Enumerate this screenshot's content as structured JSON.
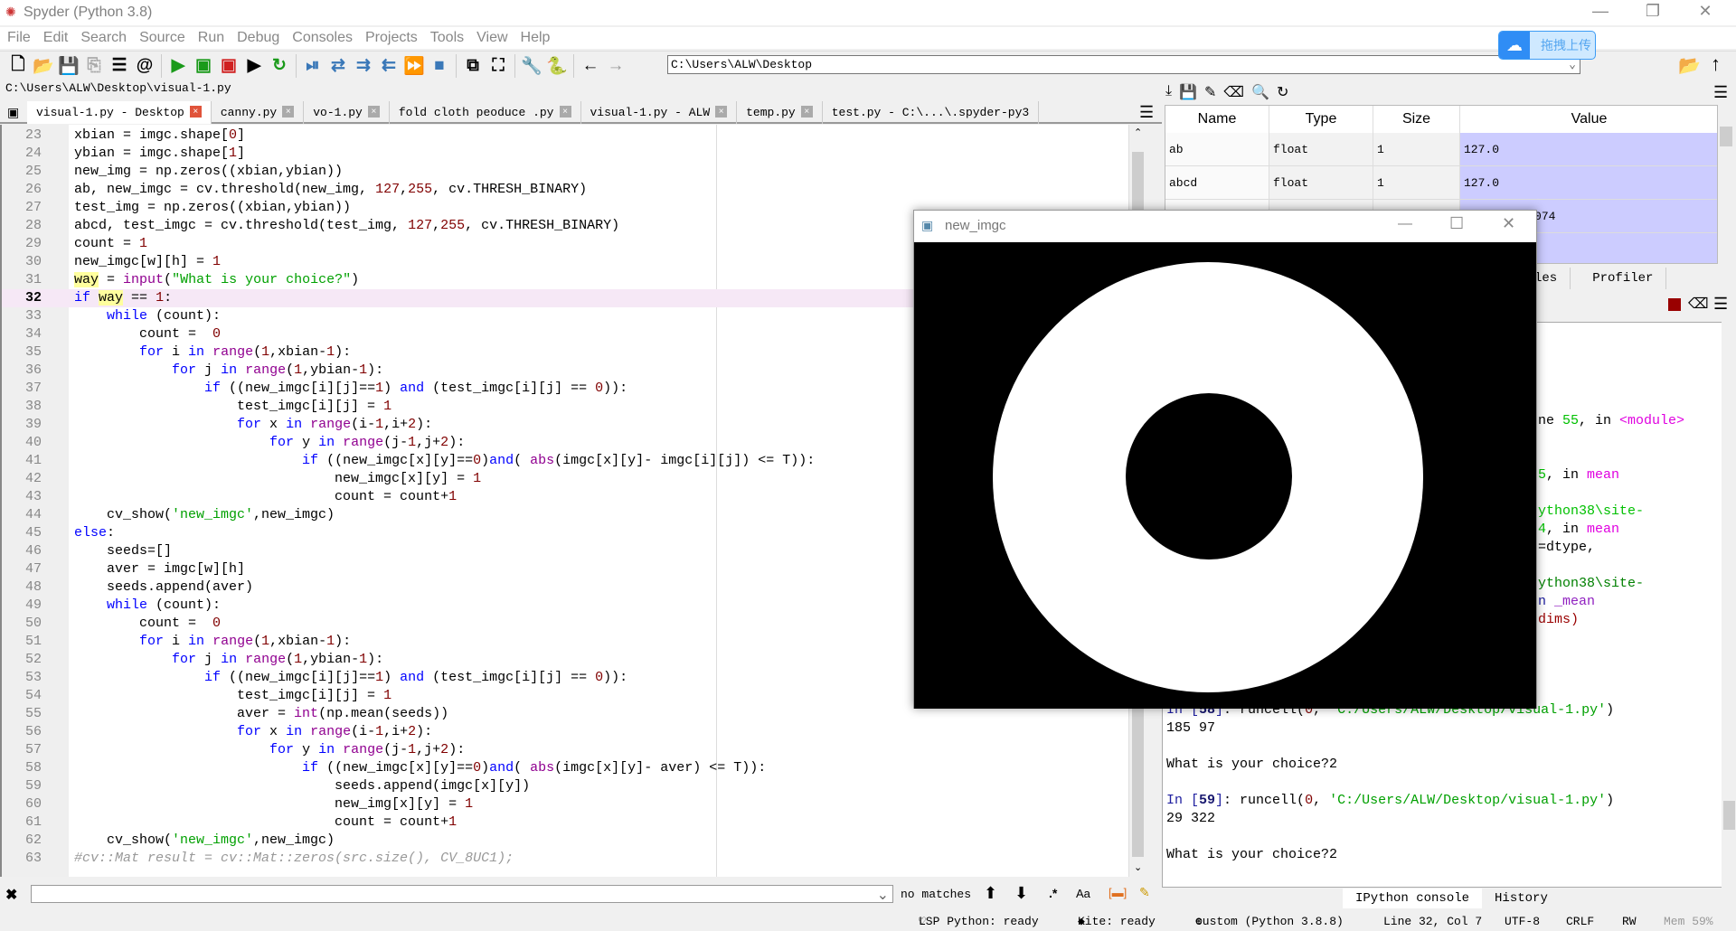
{
  "window": {
    "title": "Spyder (Python 3.8)",
    "minimize": "—",
    "restore": "❐",
    "close": "✕"
  },
  "menu": [
    "File",
    "Edit",
    "Search",
    "Source",
    "Run",
    "Debug",
    "Consoles",
    "Projects",
    "Tools",
    "View",
    "Help"
  ],
  "toolbar": {
    "icons": [
      {
        "name": "new-file-icon",
        "g": "🗋",
        "c": "#000"
      },
      {
        "name": "open-file-icon",
        "g": "📂",
        "c": "#000"
      },
      {
        "name": "save-icon",
        "g": "💾",
        "c": "#aaa"
      },
      {
        "name": "save-all-icon",
        "g": "⎘",
        "c": "#aaa"
      },
      {
        "name": "outline-icon",
        "g": "☰",
        "c": "#000"
      },
      {
        "name": "at-icon",
        "g": "@",
        "c": "#000"
      },
      "sep",
      {
        "name": "run-icon",
        "g": "▶",
        "c": "#1a9a1a"
      },
      {
        "name": "run-cell-icon",
        "g": "▣",
        "c": "#1a9a1a"
      },
      {
        "name": "run-cell-advance-icon",
        "g": "▣",
        "c": "#d02020"
      },
      {
        "name": "run-selection-icon",
        "g": "▶",
        "c": "#000"
      },
      {
        "name": "rerun-icon",
        "g": "↻",
        "c": "#1a9a1a"
      },
      "sep",
      {
        "name": "debug-icon",
        "g": "⏯",
        "c": "#3a78b8"
      },
      {
        "name": "step-icon",
        "g": "⇄",
        "c": "#3a78b8"
      },
      {
        "name": "step-into-icon",
        "g": "⇉",
        "c": "#3a78b8"
      },
      {
        "name": "step-return-icon",
        "g": "⇇",
        "c": "#3a78b8"
      },
      {
        "name": "continue-icon",
        "g": "⏩",
        "c": "#3a78b8"
      },
      {
        "name": "stop-debug-icon",
        "g": "■",
        "c": "#3a78b8"
      },
      "sep",
      {
        "name": "maximize-pane-icon",
        "g": "⧉",
        "c": "#000"
      },
      {
        "name": "fullscreen-icon",
        "g": "⛶",
        "c": "#000"
      },
      "sep",
      {
        "name": "preferences-wrench-icon",
        "g": "🔧",
        "c": "#000"
      },
      {
        "name": "python-path-icon",
        "g": "🐍",
        "c": "#e0b020"
      },
      "sep",
      {
        "name": "back-arrow-icon",
        "g": "←",
        "c": "#000"
      },
      {
        "name": "forward-arrow-icon",
        "g": "→",
        "c": "#999"
      }
    ],
    "path": "C:\\Users\\ALW\\Desktop"
  },
  "upload_button": {
    "label": "拖拽上传"
  },
  "editor": {
    "filepath": "C:\\Users\\ALW\\Desktop\\visual-1.py",
    "tabs": [
      "visual-1.py - Desktop",
      "canny.py",
      "vo-1.py",
      "fold cloth peoduce .py",
      "visual-1.py - ALW",
      "temp.py",
      "test.py - C:\\...\\.spyder-py3"
    ],
    "current_line": 32,
    "lines": [
      [
        [
          "n",
          "xbian = imgc.shape["
        ],
        [
          "num",
          "0"
        ],
        [
          "n",
          "]"
        ]
      ],
      [
        [
          "n",
          "ybian = imgc.shape["
        ],
        [
          "num",
          "1"
        ],
        [
          "n",
          "]"
        ]
      ],
      [
        [
          "n",
          "new_img = np.zeros((xbian,ybian))"
        ]
      ],
      [
        [
          "n",
          "ab, new_imgc = cv.threshold(new_img, "
        ],
        [
          "num",
          "127"
        ],
        [
          "n",
          ","
        ],
        [
          "num",
          "255"
        ],
        [
          "n",
          ", cv.THRESH_BINARY)"
        ]
      ],
      [
        [
          "n",
          "test_img = np.zeros((xbian,ybian))"
        ]
      ],
      [
        [
          "n",
          "abcd, test_imgc = cv.threshold(test_img, "
        ],
        [
          "num",
          "127"
        ],
        [
          "n",
          ","
        ],
        [
          "num",
          "255"
        ],
        [
          "n",
          ", cv.THRESH_BINARY)"
        ]
      ],
      [
        [
          "n",
          "count = "
        ],
        [
          "num",
          "1"
        ]
      ],
      [
        [
          "n",
          "new_imgc[w][h] = "
        ],
        [
          "num",
          "1"
        ]
      ],
      [
        [
          "h",
          "way"
        ],
        [
          "n",
          " = "
        ],
        [
          "b",
          "input"
        ],
        [
          "n",
          "("
        ],
        [
          "s",
          "\"What is your choice?\""
        ],
        [
          "n",
          ")"
        ]
      ],
      [
        [
          "k",
          "if"
        ],
        [
          "n",
          " "
        ],
        [
          "h",
          "way"
        ],
        [
          "n",
          " == "
        ],
        [
          "num",
          "1"
        ],
        [
          "n",
          ":"
        ]
      ],
      [
        [
          "n",
          "    "
        ],
        [
          "k",
          "while"
        ],
        [
          "n",
          " (count):"
        ]
      ],
      [
        [
          "n",
          "        count =  "
        ],
        [
          "num",
          "0"
        ]
      ],
      [
        [
          "n",
          "        "
        ],
        [
          "k",
          "for"
        ],
        [
          "n",
          " i "
        ],
        [
          "k",
          "in"
        ],
        [
          "n",
          " "
        ],
        [
          "b",
          "range"
        ],
        [
          "n",
          "("
        ],
        [
          "num",
          "1"
        ],
        [
          "n",
          ",xbian-"
        ],
        [
          "num",
          "1"
        ],
        [
          "n",
          "):"
        ]
      ],
      [
        [
          "n",
          "            "
        ],
        [
          "k",
          "for"
        ],
        [
          "n",
          " j "
        ],
        [
          "k",
          "in"
        ],
        [
          "n",
          " "
        ],
        [
          "b",
          "range"
        ],
        [
          "n",
          "("
        ],
        [
          "num",
          "1"
        ],
        [
          "n",
          ",ybian-"
        ],
        [
          "num",
          "1"
        ],
        [
          "n",
          "):"
        ]
      ],
      [
        [
          "n",
          "                "
        ],
        [
          "k",
          "if"
        ],
        [
          "n",
          " ((new_imgc[i][j]=="
        ],
        [
          "num",
          "1"
        ],
        [
          "n",
          ") "
        ],
        [
          "k",
          "and"
        ],
        [
          "n",
          " (test_imgc[i][j] == "
        ],
        [
          "num",
          "0"
        ],
        [
          "n",
          ")):"
        ]
      ],
      [
        [
          "n",
          "                    test_imgc[i][j] = "
        ],
        [
          "num",
          "1"
        ]
      ],
      [
        [
          "n",
          "                    "
        ],
        [
          "k",
          "for"
        ],
        [
          "n",
          " x "
        ],
        [
          "k",
          "in"
        ],
        [
          "n",
          " "
        ],
        [
          "b",
          "range"
        ],
        [
          "n",
          "(i-"
        ],
        [
          "num",
          "1"
        ],
        [
          "n",
          ",i+"
        ],
        [
          "num",
          "2"
        ],
        [
          "n",
          "):"
        ]
      ],
      [
        [
          "n",
          "                        "
        ],
        [
          "k",
          "for"
        ],
        [
          "n",
          " y "
        ],
        [
          "k",
          "in"
        ],
        [
          "n",
          " "
        ],
        [
          "b",
          "range"
        ],
        [
          "n",
          "(j-"
        ],
        [
          "num",
          "1"
        ],
        [
          "n",
          ",j+"
        ],
        [
          "num",
          "2"
        ],
        [
          "n",
          "):"
        ]
      ],
      [
        [
          "n",
          "                            "
        ],
        [
          "k",
          "if"
        ],
        [
          "n",
          " ((new_imgc[x][y]=="
        ],
        [
          "num",
          "0"
        ],
        [
          "n",
          ")"
        ],
        [
          "k",
          "and"
        ],
        [
          "n",
          "( "
        ],
        [
          "b",
          "abs"
        ],
        [
          "n",
          "(imgc[x][y]- imgc[i][j]) <= T)):"
        ]
      ],
      [
        [
          "n",
          "                                new_imgc[x][y] = "
        ],
        [
          "num",
          "1"
        ]
      ],
      [
        [
          "n",
          "                                count = count+"
        ],
        [
          "num",
          "1"
        ]
      ],
      [
        [
          "n",
          "    cv_show("
        ],
        [
          "s",
          "'new_imgc'"
        ],
        [
          "n",
          ",new_imgc)"
        ]
      ],
      [
        [
          "k",
          "else"
        ],
        [
          "n",
          ":"
        ]
      ],
      [
        [
          "n",
          "    seeds=[]"
        ]
      ],
      [
        [
          "n",
          "    aver = imgc[w][h]"
        ]
      ],
      [
        [
          "n",
          "    seeds.append(aver)"
        ]
      ],
      [
        [
          "n",
          "    "
        ],
        [
          "k",
          "while"
        ],
        [
          "n",
          " (count):"
        ]
      ],
      [
        [
          "n",
          "        count =  "
        ],
        [
          "num",
          "0"
        ]
      ],
      [
        [
          "n",
          "        "
        ],
        [
          "k",
          "for"
        ],
        [
          "n",
          " i "
        ],
        [
          "k",
          "in"
        ],
        [
          "n",
          " "
        ],
        [
          "b",
          "range"
        ],
        [
          "n",
          "("
        ],
        [
          "num",
          "1"
        ],
        [
          "n",
          ",xbian-"
        ],
        [
          "num",
          "1"
        ],
        [
          "n",
          "):"
        ]
      ],
      [
        [
          "n",
          "            "
        ],
        [
          "k",
          "for"
        ],
        [
          "n",
          " j "
        ],
        [
          "k",
          "in"
        ],
        [
          "n",
          " "
        ],
        [
          "b",
          "range"
        ],
        [
          "n",
          "("
        ],
        [
          "num",
          "1"
        ],
        [
          "n",
          ",ybian-"
        ],
        [
          "num",
          "1"
        ],
        [
          "n",
          "):"
        ]
      ],
      [
        [
          "n",
          "                "
        ],
        [
          "k",
          "if"
        ],
        [
          "n",
          " ((new_imgc[i][j]=="
        ],
        [
          "num",
          "1"
        ],
        [
          "n",
          ") "
        ],
        [
          "k",
          "and"
        ],
        [
          "n",
          " (test_imgc[i][j] == "
        ],
        [
          "num",
          "0"
        ],
        [
          "n",
          ")):"
        ]
      ],
      [
        [
          "n",
          "                    test_imgc[i][j] = "
        ],
        [
          "num",
          "1"
        ]
      ],
      [
        [
          "n",
          "                    aver = "
        ],
        [
          "b",
          "int"
        ],
        [
          "n",
          "(np.mean(seeds))"
        ]
      ],
      [
        [
          "n",
          "                    "
        ],
        [
          "k",
          "for"
        ],
        [
          "n",
          " x "
        ],
        [
          "k",
          "in"
        ],
        [
          "n",
          " "
        ],
        [
          "b",
          "range"
        ],
        [
          "n",
          "(i-"
        ],
        [
          "num",
          "1"
        ],
        [
          "n",
          ",i+"
        ],
        [
          "num",
          "2"
        ],
        [
          "n",
          "):"
        ]
      ],
      [
        [
          "n",
          "                        "
        ],
        [
          "k",
          "for"
        ],
        [
          "n",
          " y "
        ],
        [
          "k",
          "in"
        ],
        [
          "n",
          " "
        ],
        [
          "b",
          "range"
        ],
        [
          "n",
          "(j-"
        ],
        [
          "num",
          "1"
        ],
        [
          "n",
          ",j+"
        ],
        [
          "num",
          "2"
        ],
        [
          "n",
          "):"
        ]
      ],
      [
        [
          "n",
          "                            "
        ],
        [
          "k",
          "if"
        ],
        [
          "n",
          " ((new_imgc[x][y]=="
        ],
        [
          "num",
          "0"
        ],
        [
          "n",
          ")"
        ],
        [
          "k",
          "and"
        ],
        [
          "n",
          "( "
        ],
        [
          "b",
          "abs"
        ],
        [
          "n",
          "(imgc[x][y]- aver) <= T)):"
        ]
      ],
      [
        [
          "n",
          "                                seeds.append(imgc[x][y])"
        ]
      ],
      [
        [
          "n",
          "                                new_img[x][y] = "
        ],
        [
          "num",
          "1"
        ]
      ],
      [
        [
          "n",
          "                                count = count+"
        ],
        [
          "num",
          "1"
        ]
      ],
      [
        [
          "n",
          "    cv_show("
        ],
        [
          "s",
          "'new_imgc'"
        ],
        [
          "n",
          ",new_imgc)"
        ]
      ],
      [
        [
          "c",
          "#cv::Mat result = cv::Mat::zeros(src.size(), CV_8UC1);"
        ]
      ]
    ],
    "first_line": 23
  },
  "find": {
    "status": "no matches",
    "regex": ".*",
    "case": "Aa"
  },
  "variables": {
    "headers": [
      "Name",
      "Type",
      "Size",
      "Value"
    ],
    "rows": [
      [
        "ab",
        "float",
        "1",
        "127.0"
      ],
      [
        "abcd",
        "float",
        "1",
        "127.0"
      ],
      [
        "",
        "",
        "",
        "5048000000074"
      ],
      [
        "",
        "",
        "",
        ""
      ]
    ]
  },
  "pane_tabs": [
    "les",
    "Profiler"
  ],
  "console": {
    "fragments": [
      [
        [
          "n",
          "ne "
        ],
        [
          "g",
          "55"
        ],
        [
          "n",
          ", in "
        ],
        [
          "m",
          "<module>"
        ]
      ],
      [
        [
          "g",
          "5"
        ],
        [
          "n",
          ", in "
        ],
        [
          "m",
          "mean"
        ]
      ],
      [
        [
          "g",
          "ython38\\site-"
        ]
      ],
      [
        [
          "g",
          "4"
        ],
        [
          "n",
          ", in "
        ],
        [
          "m",
          "mean"
        ]
      ],
      [
        [
          "n",
          "=dtype,"
        ]
      ],
      [
        [
          "dg",
          "ython38\\site-"
        ]
      ],
      [
        [
          "bl",
          "n "
        ],
        [
          "p",
          "_mean"
        ]
      ],
      [
        [
          "dr",
          "dims)"
        ]
      ]
    ],
    "lines": [
      [
        [
          "bl",
          "In ["
        ],
        [
          "bb",
          "58"
        ],
        [
          "bl",
          "]"
        ],
        [
          "n",
          ": runcell("
        ],
        [
          "num",
          "0"
        ],
        [
          "n",
          ", "
        ],
        [
          "s",
          "'C:/Users/ALW/Desktop/visual-1.py'"
        ],
        [
          "n",
          ")"
        ]
      ],
      [
        [
          "n",
          "185 97"
        ]
      ],
      [
        [
          "n",
          ""
        ]
      ],
      [
        [
          "n",
          "What is your choice?2"
        ]
      ],
      [
        [
          "n",
          ""
        ]
      ],
      [
        [
          "bl",
          "In ["
        ],
        [
          "bb",
          "59"
        ],
        [
          "bl",
          "]"
        ],
        [
          "n",
          ": runcell("
        ],
        [
          "num",
          "0"
        ],
        [
          "n",
          ", "
        ],
        [
          "s",
          "'C:/Users/ALW/Desktop/visual-1.py'"
        ],
        [
          "n",
          ")"
        ]
      ],
      [
        [
          "n",
          "29 322"
        ]
      ],
      [
        [
          "n",
          ""
        ]
      ],
      [
        [
          "n",
          "What is your choice?2"
        ]
      ]
    ],
    "tabs": [
      "IPython console",
      "History"
    ]
  },
  "popup": {
    "title": "new_imgc"
  },
  "status": [
    "LSP Python: ready",
    "Kite: ready",
    "custom (Python 3.8.8)",
    "Line 32, Col 7",
    "UTF-8",
    "CRLF",
    "RW",
    "Mem 59%"
  ],
  "colors": {
    "keyword": "#0000ff",
    "builtin": "#900090",
    "number": "#800000",
    "string": "#00a000",
    "value_cell": "#ccccff",
    "current_line": "#f6e8f6"
  }
}
